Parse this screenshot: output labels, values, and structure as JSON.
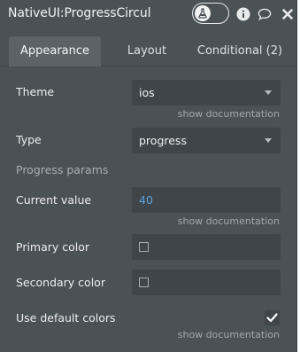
{
  "header": {
    "title": "NativeUI:ProgressCircula",
    "toggle_icon": "flask-icon",
    "icons": [
      "info-icon",
      "comment-icon",
      "close-icon"
    ]
  },
  "tabs": [
    {
      "label": "Appearance",
      "active": true
    },
    {
      "label": "Layout",
      "active": false
    },
    {
      "label": "Conditional (2)",
      "active": false
    }
  ],
  "fields": {
    "theme": {
      "label": "Theme",
      "value": "ios",
      "doc": "show documentation"
    },
    "type": {
      "label": "Type",
      "value": "progress"
    },
    "section": "Progress params",
    "current_value": {
      "label": "Current value",
      "value": "40",
      "doc": "show documentation"
    },
    "primary_color": {
      "label": "Primary color",
      "checked": false
    },
    "secondary_color": {
      "label": "Secondary color",
      "checked": false
    },
    "use_default_colors": {
      "label": "Use default colors",
      "checked": true,
      "doc": "show documentation"
    }
  },
  "colors": {
    "panel_bg": "#4b5256",
    "field_bg": "#3f4549",
    "accent_blue": "#5ba1dd"
  }
}
